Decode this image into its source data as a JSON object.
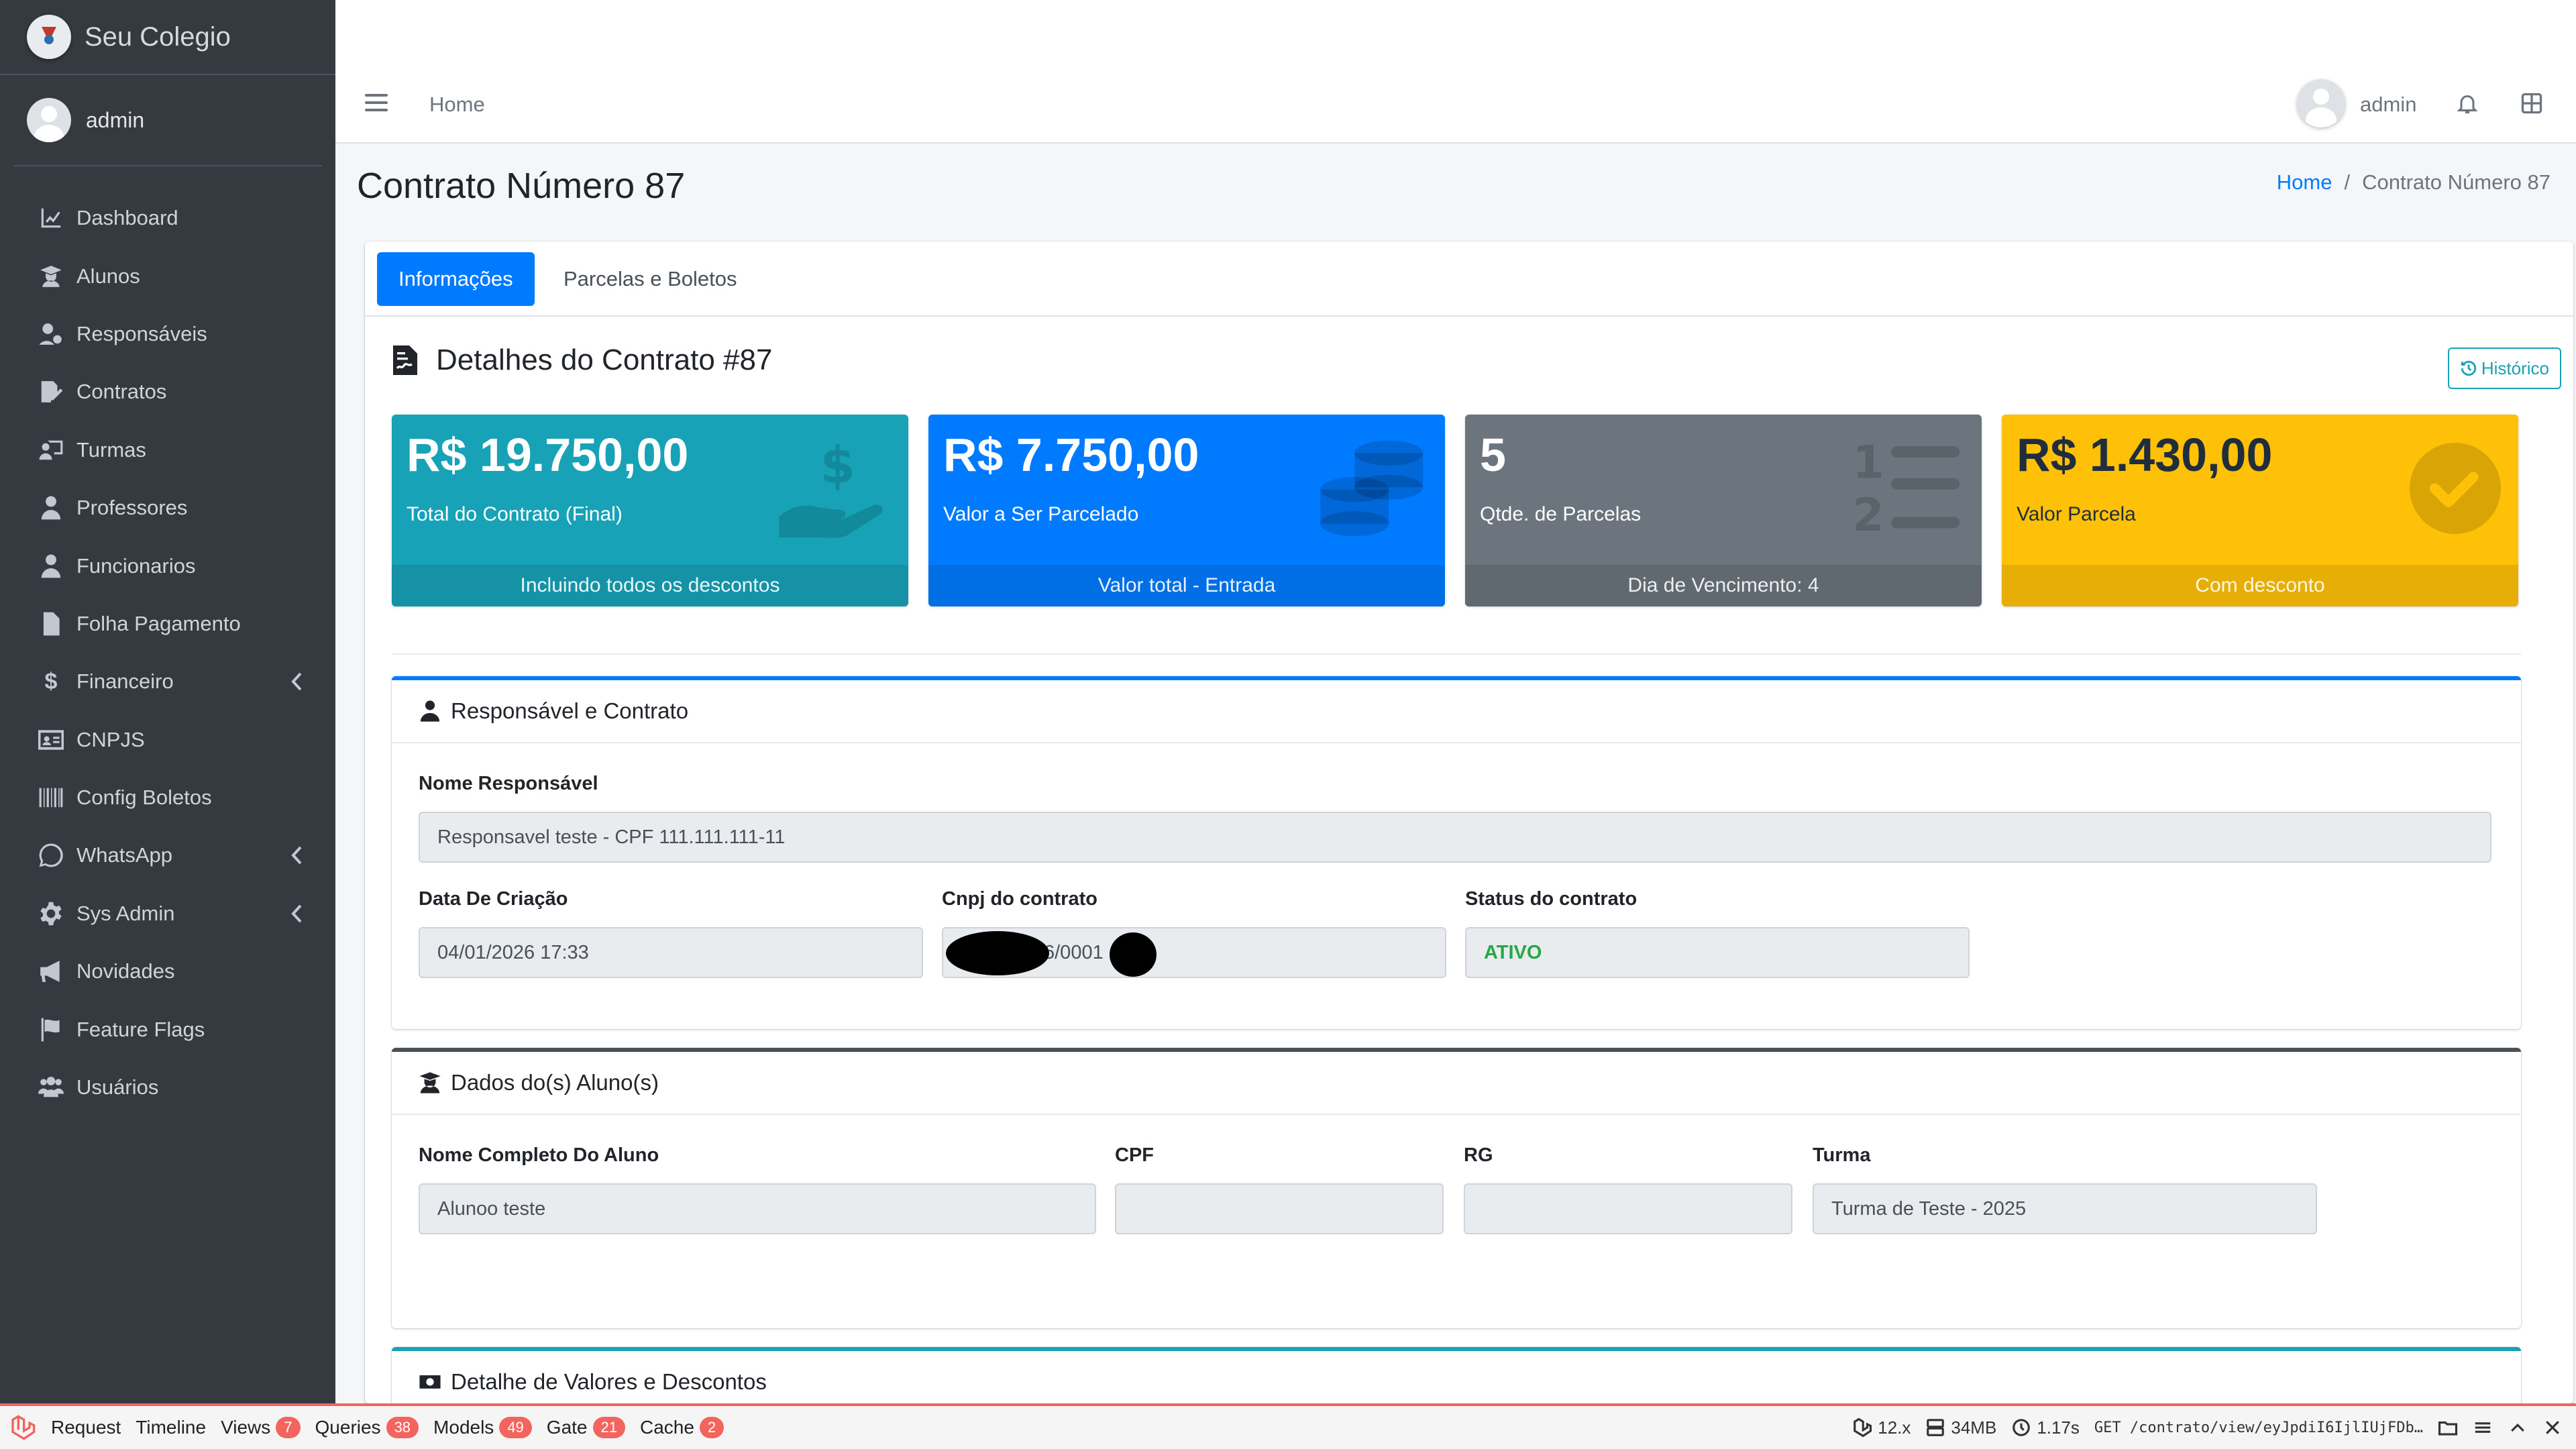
{
  "brand": {
    "name": "Seu Colegio"
  },
  "sidebar": {
    "user": "admin",
    "items": [
      {
        "label": "Dashboard",
        "icon": "chart-line-icon",
        "has_children": false
      },
      {
        "label": "Alunos",
        "icon": "user-graduate-icon",
        "has_children": false
      },
      {
        "label": "Responsáveis",
        "icon": "user-cog-icon",
        "has_children": false
      },
      {
        "label": "Contratos",
        "icon": "file-signature-icon",
        "has_children": false
      },
      {
        "label": "Turmas",
        "icon": "chalkboard-teacher-icon",
        "has_children": false
      },
      {
        "label": "Professores",
        "icon": "user-tie-icon",
        "has_children": false
      },
      {
        "label": "Funcionarios",
        "icon": "user-icon",
        "has_children": false
      },
      {
        "label": "Folha Pagamento",
        "icon": "file-invoice-icon",
        "has_children": false
      },
      {
        "label": "Financeiro",
        "icon": "dollar-icon",
        "has_children": true
      },
      {
        "label": "CNPJS",
        "icon": "id-card-icon",
        "has_children": false
      },
      {
        "label": "Config Boletos",
        "icon": "barcode-icon",
        "has_children": false
      },
      {
        "label": "WhatsApp",
        "icon": "whatsapp-icon",
        "has_children": true
      },
      {
        "label": "Sys Admin",
        "icon": "cog-icon",
        "has_children": true
      },
      {
        "label": "Novidades",
        "icon": "bullhorn-icon",
        "has_children": false
      },
      {
        "label": "Feature Flags",
        "icon": "flag-icon",
        "has_children": false
      },
      {
        "label": "Usuários",
        "icon": "users-cog-icon",
        "has_children": false
      }
    ]
  },
  "topbar": {
    "home": "Home",
    "user": "admin"
  },
  "page": {
    "title": "Contrato Número 87",
    "breadcrumb": {
      "home": "Home",
      "current": "Contrato Número 87"
    }
  },
  "tabs": [
    {
      "label": "Informações",
      "active": true
    },
    {
      "label": "Parcelas e Boletos",
      "active": false
    }
  ],
  "details": {
    "title": "Detalhes do Contrato #87",
    "history_button": "Histórico"
  },
  "small_boxes": [
    {
      "value": "R$ 19.750,00",
      "label": "Total do Contrato (Final)",
      "footer": "Incluindo todos os descontos",
      "color": "#17a2b8",
      "icon": "hand-holding-usd-icon"
    },
    {
      "value": "R$ 7.750,00",
      "label": "Valor a Ser Parcelado",
      "footer": "Valor total - Entrada",
      "color": "#007bff",
      "icon": "coins-icon"
    },
    {
      "value": "5",
      "label": "Qtde. de Parcelas",
      "footer": "Dia de Vencimento: 4",
      "color": "#6c757d",
      "icon": "list-ol-icon"
    },
    {
      "value": "R$ 1.430,00",
      "label": "Valor Parcela",
      "footer": "Com desconto",
      "color": "#ffc107",
      "icon": "check-circle-icon"
    }
  ],
  "responsavel_card": {
    "title": "Responsável e Contrato",
    "nome_label": "Nome Responsável",
    "nome_value": "Responsavel teste - CPF 111.111.111-11",
    "data_label": "Data De Criação",
    "data_value": "04/01/2026 17:33",
    "cnpj_label": "Cnpj do contrato",
    "cnpj_value": "6/0001",
    "status_label": "Status do contrato",
    "status_value": "ATIVO",
    "status_color": "#28a745"
  },
  "aluno_card": {
    "title": "Dados do(s) Aluno(s)",
    "nome_label": "Nome Completo Do Aluno",
    "nome_value": "Alunoo teste",
    "cpf_label": "CPF",
    "cpf_value": "",
    "rg_label": "RG",
    "rg_value": "",
    "turma_label": "Turma",
    "turma_value": "Turma de Teste - 2025"
  },
  "valores_card": {
    "title": "Detalhe de Valores e Descontos"
  },
  "debugbar": {
    "items": [
      {
        "label": "Request",
        "count": ""
      },
      {
        "label": "Timeline",
        "count": ""
      },
      {
        "label": "Views",
        "count": "7"
      },
      {
        "label": "Queries",
        "count": "38"
      },
      {
        "label": "Models",
        "count": "49"
      },
      {
        "label": "Gate",
        "count": "21"
      },
      {
        "label": "Cache",
        "count": "2"
      }
    ],
    "version": "12.x",
    "memory": "34MB",
    "time": "1.17s",
    "request": "GET /contrato/view/eyJpdiI6IjlIUjFDb…"
  }
}
